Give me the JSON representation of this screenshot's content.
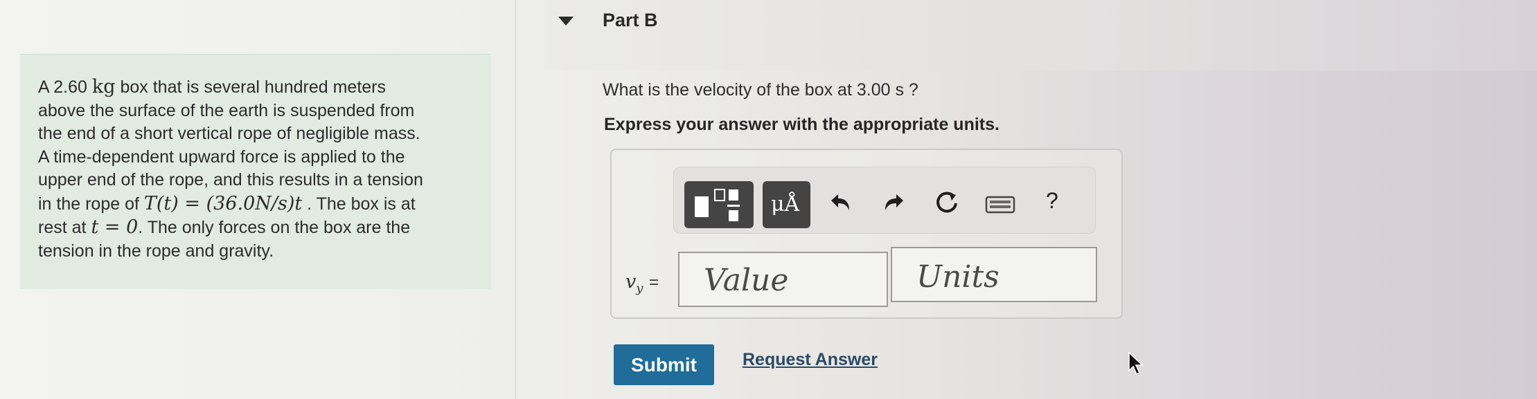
{
  "problem": {
    "line1_pre": "A 2.60",
    "line1_unit": "kg",
    "line1_post": " box that is several hundred meters",
    "line2": "above the surface of the earth is suspended from",
    "line3": "the end of a short vertical rope of negligible mass.",
    "line4": "A time-dependent upward force is applied to the",
    "line5": "upper end of the rope, and this results in a tension",
    "line6_pre": "in the rope of",
    "line6_math": "T(t) = (36.0N/s)t",
    "line6_post": " . The box is at",
    "line7_pre": "rest at",
    "line7_math": "t = 0",
    "line7_post": ". The only forces on the box are the",
    "line8": "tension in the rope and gravity."
  },
  "part": {
    "title": "Part B",
    "question": "What is the velocity of the box at 3.00 s ?",
    "instruction": "Express your answer with the appropriate units."
  },
  "toolbar": {
    "units_label": "μÅ",
    "help_label": "?"
  },
  "answer": {
    "variable": "v",
    "variable_sub": "y",
    "equals": "=",
    "value_placeholder": "Value",
    "units_placeholder": "Units"
  },
  "actions": {
    "submit_label": "Submit",
    "request_label": "Request Answer"
  },
  "colors": {
    "submit_bg": "#1f6d98",
    "problem_bg": "#e2ebe2"
  }
}
